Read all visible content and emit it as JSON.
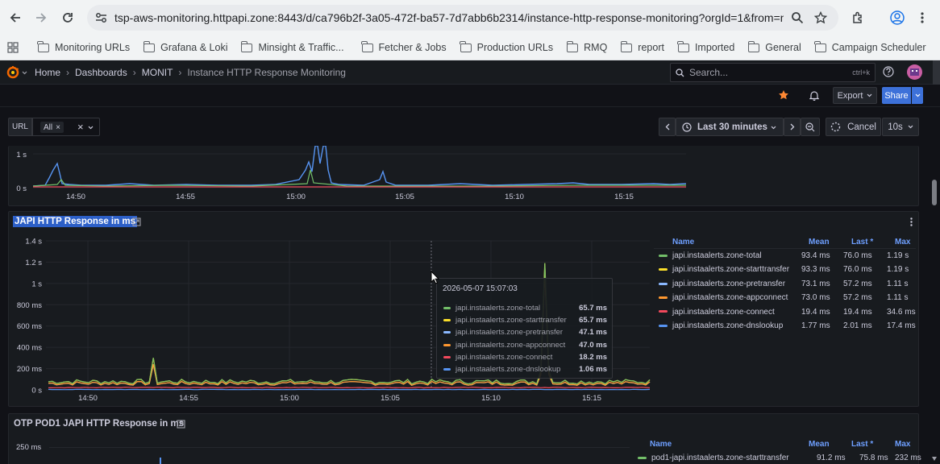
{
  "browser": {
    "url": "tsp-aws-monitoring.httpapi.zone:8443/d/ca796b2f-3a05-472f-ba57-7d7abb6b2314/instance-http-response-monitoring?orgId=1&from=now-30...",
    "bookmarks": [
      "Monitoring URLs",
      "Grafana & Loki",
      "Minsight & Traffic...",
      "Fetcher & Jobs",
      "Production URLs",
      "RMQ",
      "report",
      "Imported",
      "General",
      "Campaign Scheduler"
    ]
  },
  "grafana": {
    "breadcrumbs": [
      "Home",
      "Dashboards",
      "MONIT",
      "Instance HTTP Response Monitoring"
    ],
    "search_placeholder": "Search...",
    "search_shortcut": "ctrl+k",
    "export_label": "Export",
    "share_label": "Share"
  },
  "variables": {
    "url_label": "URL",
    "url_value": "All",
    "time_range": "Last 30 minutes",
    "cancel_label": "Cancel",
    "refresh_interval": "10s"
  },
  "panel_top": {
    "y_ticks": [
      "1 s",
      "0 s"
    ],
    "x_ticks": [
      "14:50",
      "14:55",
      "15:00",
      "15:05",
      "15:10",
      "15:15"
    ]
  },
  "panel_main": {
    "title": "JAPI HTTP Response in ms",
    "y_ticks": [
      "1.4 s",
      "1.2 s",
      "1 s",
      "800 ms",
      "600 ms",
      "400 ms",
      "200 ms",
      "0 s"
    ],
    "x_ticks": [
      "14:50",
      "14:55",
      "15:00",
      "15:05",
      "15:10",
      "15:15"
    ],
    "legend_headers": {
      "name": "Name",
      "mean": "Mean",
      "last": "Last *",
      "max": "Max"
    },
    "legend": [
      {
        "name": "japi.instaalerts.zone-total",
        "mean": "93.4 ms",
        "last": "76.0 ms",
        "max": "1.19 s",
        "color": "#73bf69"
      },
      {
        "name": "japi.instaalerts.zone-starttransfer",
        "mean": "93.3 ms",
        "last": "76.0 ms",
        "max": "1.19 s",
        "color": "#fade2a"
      },
      {
        "name": "japi.instaalerts.zone-pretransfer",
        "mean": "73.1 ms",
        "last": "57.2 ms",
        "max": "1.11 s",
        "color": "#8ab8ff"
      },
      {
        "name": "japi.instaalerts.zone-appconnect",
        "mean": "73.0 ms",
        "last": "57.2 ms",
        "max": "1.11 s",
        "color": "#ff9830"
      },
      {
        "name": "japi.instaalerts.zone-connect",
        "mean": "19.4 ms",
        "last": "19.4 ms",
        "max": "34.6 ms",
        "color": "#f2495c"
      },
      {
        "name": "japi.instaalerts.zone-dnslookup",
        "mean": "1.77 ms",
        "last": "2.01 ms",
        "max": "17.4 ms",
        "color": "#5794f2"
      }
    ],
    "tooltip": {
      "time": "2026-05-07 15:07:03",
      "rows": [
        {
          "name": "japi.instaalerts.zone-total",
          "value": "65.7 ms",
          "color": "#73bf69"
        },
        {
          "name": "japi.instaalerts.zone-starttransfer",
          "value": "65.7 ms",
          "color": "#fade2a"
        },
        {
          "name": "japi.instaalerts.zone-pretransfer",
          "value": "47.1 ms",
          "color": "#8ab8ff"
        },
        {
          "name": "japi.instaalerts.zone-appconnect",
          "value": "47.0 ms",
          "color": "#ff9830"
        },
        {
          "name": "japi.instaalerts.zone-connect",
          "value": "18.2 ms",
          "color": "#f2495c"
        },
        {
          "name": "japi.instaalerts.zone-dnslookup",
          "value": "1.06 ms",
          "color": "#5794f2"
        }
      ]
    }
  },
  "panel_bottom": {
    "title": "OTP POD1 JAPI HTTP Response in ms",
    "y_tick": "250 ms",
    "legend_headers": {
      "name": "Name",
      "mean": "Mean",
      "last": "Last *",
      "max": "Max"
    },
    "legend": [
      {
        "name": "pod1-japi.instaalerts.zone-starttransfer",
        "mean": "91.2 ms",
        "last": "75.8 ms",
        "max": "232 ms",
        "color": "#73bf69"
      }
    ]
  }
}
